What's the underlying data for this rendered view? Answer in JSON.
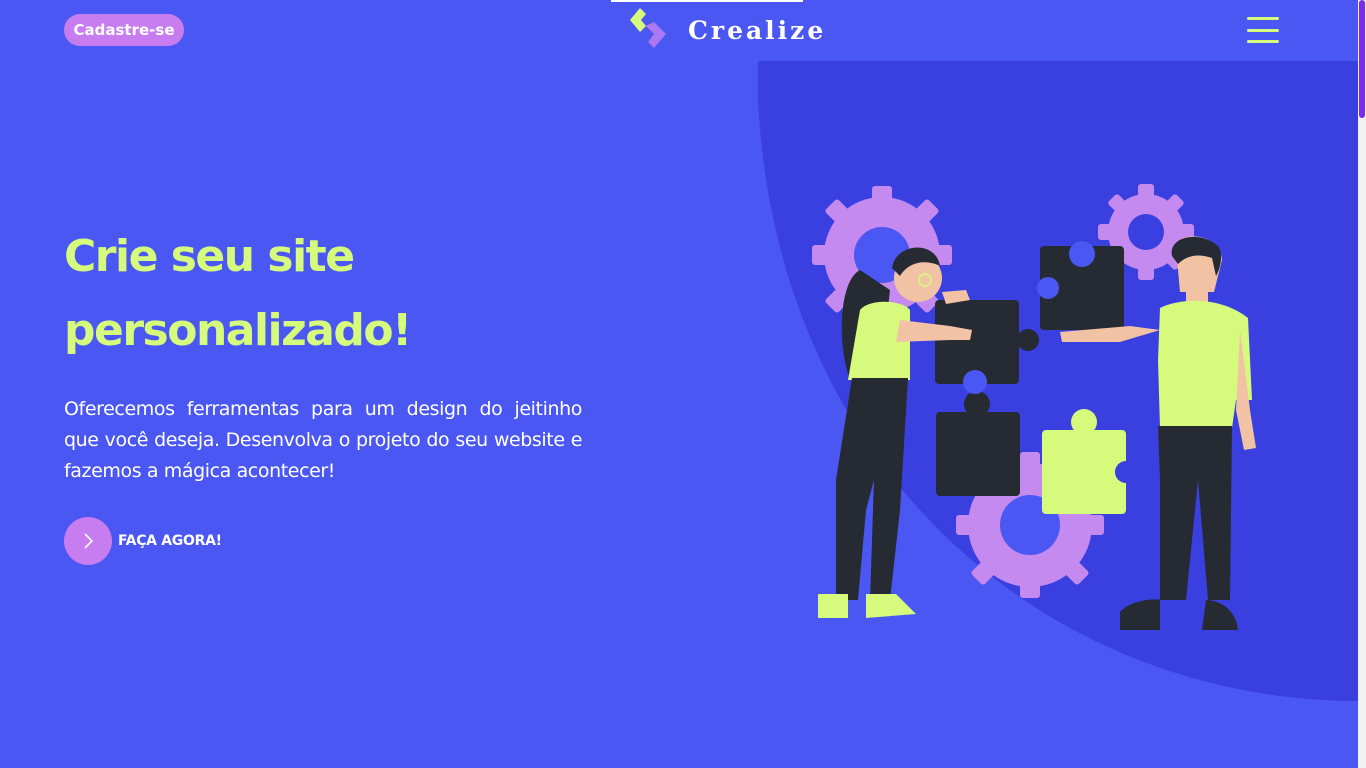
{
  "header": {
    "signup_label": "Cadastre-se",
    "brand": "Crealize",
    "menu_icon": "hamburger-menu-icon"
  },
  "hero": {
    "title_line1": "Crie seu site",
    "title_line2": "personalizado!",
    "description": "Oferecemos ferramentas para um design do jeitinho que você deseja. Desenvolva o projeto do seu website e fazemos a mágica acontecer!",
    "cta_label": "FAÇA AGORA!",
    "cta_icon": "chevron-right-icon",
    "illustration": "two-people-assembling-puzzle-with-gears-illustration"
  },
  "colors": {
    "background": "#4b57f2",
    "accent_lime": "#d6fb7c",
    "accent_purple": "#c77df0",
    "blob": "#3a3fe0",
    "dark": "#262b33"
  }
}
